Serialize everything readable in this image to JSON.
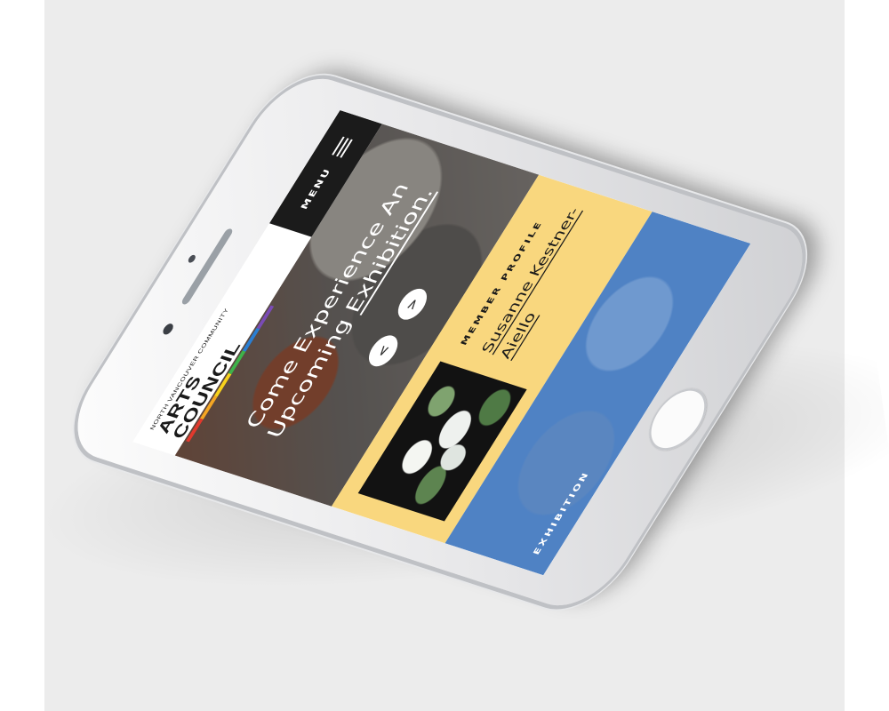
{
  "header": {
    "logo_small": "North Vancouver Community",
    "logo_main": "ARTS COUNCIL",
    "logo_colors": [
      "#e2392d",
      "#f5a623",
      "#f8d21c",
      "#3eb34a",
      "#2a7fd4",
      "#7a4bb5"
    ],
    "menu_label": "MENU"
  },
  "hero": {
    "title_line1": "Come Experience An",
    "title_line2": "Upcoming",
    "title_link": "Exhibition.",
    "prev_icon": "<",
    "next_icon": ">"
  },
  "profile": {
    "label": "MEMBER PROFILE",
    "name": "Susanne Kestner-Aiello",
    "bg_color": "#f9d77e"
  },
  "exhibition": {
    "label": "EXHIBITION",
    "bg_color": "#4f82c4"
  }
}
